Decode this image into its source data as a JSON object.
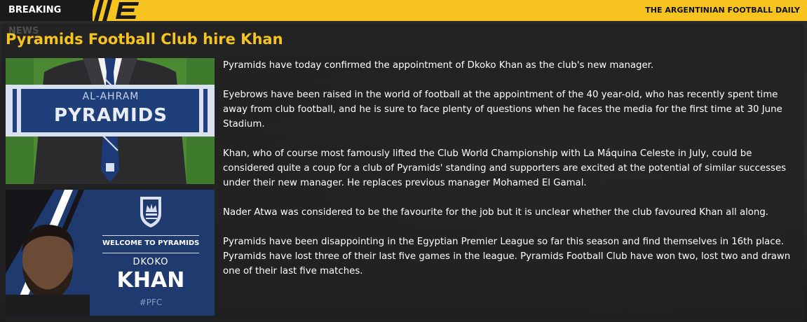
{
  "topbar": {
    "label": "BREAKING NEWS",
    "publication": "THE ARGENTINIAN FOOTBALL DAILY",
    "accent_color": "#f7c41f"
  },
  "headline": "Pyramids Football Club hire Khan",
  "scarf_image": {
    "line1": "AL-AHRAM",
    "line2": "PYRAMIDS"
  },
  "welcome_card": {
    "banner": "WELCOME TO PYRAMIDS",
    "first_name": "DKOKO",
    "last_name": "KHAN",
    "hashtag": "#PFC",
    "crest_icon": "crown-shield-icon"
  },
  "article": {
    "paragraphs": [
      "Pyramids have today confirmed the appointment of Dkoko Khan as the club's new manager.",
      "Eyebrows have been raised in the world of football at the appointment of the 40 year-old, who has recently spent time away from club football, and he is sure to face plenty of questions when he faces the media for the first time at 30 June Stadium.",
      "Khan, who of course most famously lifted the Club World Championship with La Máquina Celeste in July, could be considered quite a coup for a club of Pyramids' standing and supporters are excited at the potential of similar successes under their new manager. He replaces previous manager Mohamed El Gamal.",
      "Nader Atwa was considered to be the favourite for the job but it is unclear whether the club favoured Khan all along.",
      "Pyramids have been disappointing in the Egyptian Premier League so far this season and find themselves in 16th place. Pyramids have lost three of their last five games in the league. Pyramids Football Club have won two, lost two and drawn one of their last five matches."
    ]
  }
}
